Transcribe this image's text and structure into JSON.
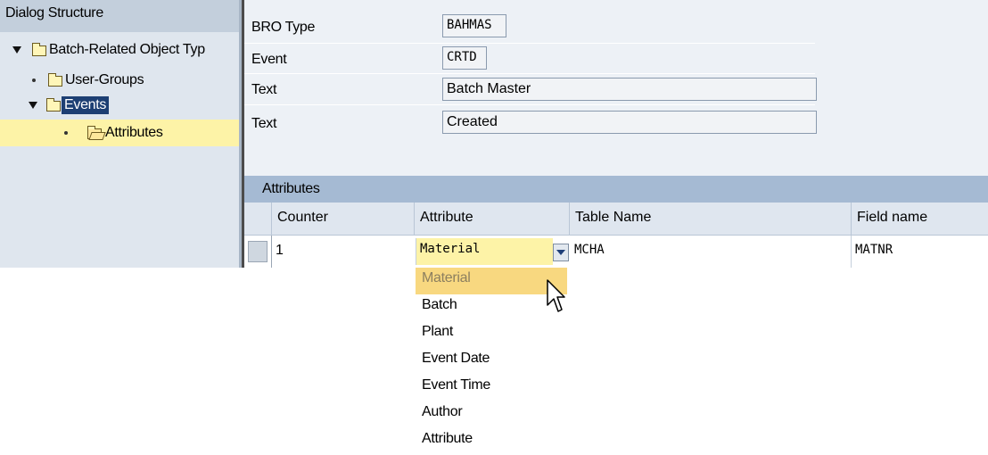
{
  "dialog_structure": {
    "title": "Dialog Structure",
    "items": [
      {
        "label": "Batch-Related Object Typ",
        "expanded": true,
        "icon": "folder-icon"
      },
      {
        "label": "User-Groups",
        "icon": "folder-icon"
      },
      {
        "label": "Events",
        "expanded": true,
        "selected": true,
        "icon": "folder-icon"
      },
      {
        "label": "Attributes",
        "current": true,
        "icon": "open-folder-icon"
      }
    ]
  },
  "header_fields": {
    "bro_type": {
      "label": "BRO Type",
      "value": "BAHMAS"
    },
    "event": {
      "label": "Event",
      "value": "CRTD"
    },
    "text1": {
      "label": "Text",
      "value": "Batch Master"
    },
    "text2": {
      "label": "Text",
      "value": "Created"
    }
  },
  "table": {
    "title": "Attributes",
    "columns": [
      "Counter",
      "Attribute",
      "Table Name",
      "Field name"
    ],
    "rows": [
      {
        "counter": "1",
        "attribute": "Material",
        "table_name": "MCHA",
        "field_name": "MATNR"
      }
    ]
  },
  "dropdown": {
    "options": [
      "Material",
      "Batch",
      "Plant",
      "Event Date",
      "Event Time",
      "Author",
      "Attribute"
    ],
    "highlighted": "Material"
  },
  "colors": {
    "panel_bg": "#dfe6ee",
    "header_bar": "#a5bad3",
    "selection_blue": "#1d3f73",
    "highlight_yellow": "#fdf3a7",
    "dropdown_highlight": "#f8d880"
  }
}
